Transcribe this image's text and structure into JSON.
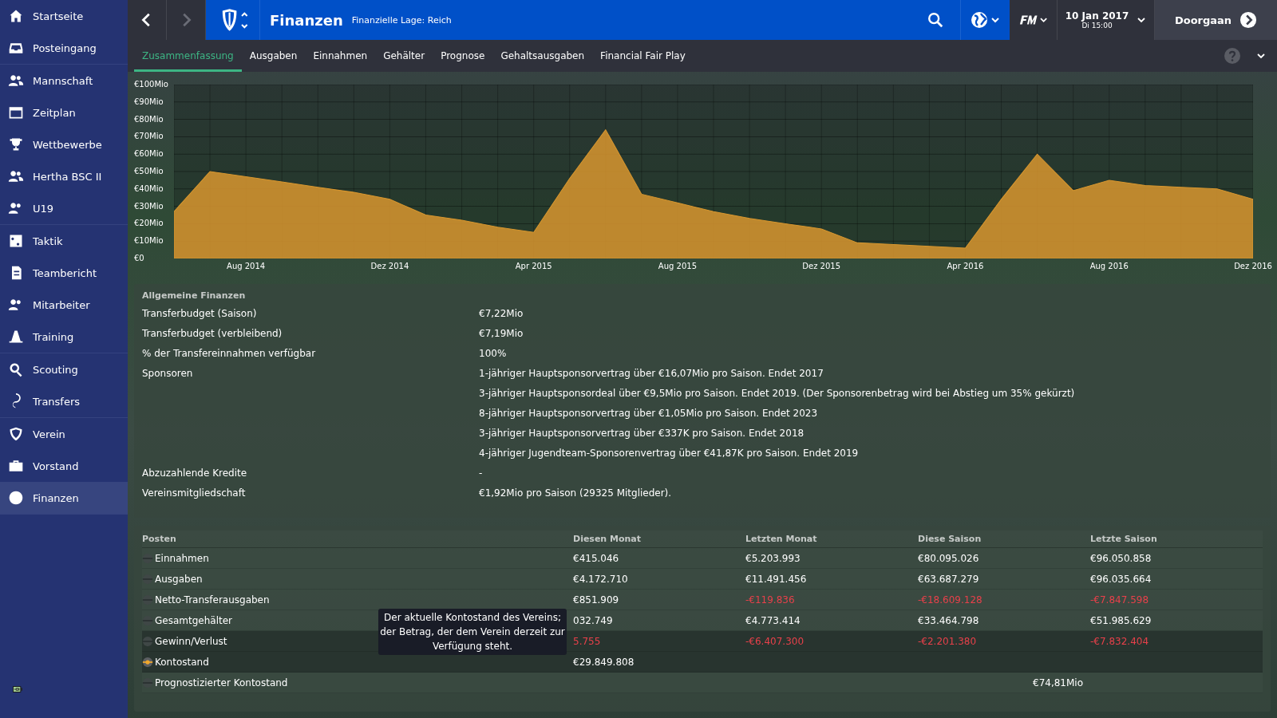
{
  "sidebar": {
    "groups": [
      [
        {
          "label": "Startseite",
          "selected": false
        },
        {
          "label": "Posteingang",
          "selected": false
        }
      ],
      [
        {
          "label": "Mannschaft",
          "selected": false
        },
        {
          "label": "Zeitplan",
          "selected": false
        },
        {
          "label": "Wettbewerbe",
          "selected": false
        },
        {
          "label": "Hertha BSC II",
          "selected": false
        },
        {
          "label": "U19",
          "selected": false
        }
      ],
      [
        {
          "label": "Taktik",
          "selected": false
        },
        {
          "label": "Teambericht",
          "selected": false
        },
        {
          "label": "Mitarbeiter",
          "selected": false
        },
        {
          "label": "Training",
          "selected": false
        }
      ],
      [
        {
          "label": "Scouting",
          "selected": false
        },
        {
          "label": "Transfers",
          "selected": false
        }
      ],
      [
        {
          "label": "Verein",
          "selected": false
        },
        {
          "label": "Vorstand",
          "selected": false
        },
        {
          "label": "Finanzen",
          "selected": true
        }
      ]
    ]
  },
  "header": {
    "title": "Finanzen",
    "subtitle": "Finanzielle Lage: Reich",
    "date": "10 Jan 2017",
    "time": "Di 15:00",
    "continue": "Doorgaan"
  },
  "tabs": [
    {
      "label": "Zusammenfassung",
      "selected": true
    },
    {
      "label": "Ausgaben",
      "selected": false
    },
    {
      "label": "Einnahmen",
      "selected": false
    },
    {
      "label": "Gehälter",
      "selected": false
    },
    {
      "label": "Prognose",
      "selected": false
    },
    {
      "label": "Gehaltsausgaben",
      "selected": false
    },
    {
      "label": "Financial Fair Play",
      "selected": false
    }
  ],
  "chart_data": {
    "type": "area",
    "categories": [
      null,
      null,
      "Aug 2014",
      null,
      null,
      null,
      "Dez 2014",
      null,
      null,
      null,
      "Apr 2015",
      null,
      null,
      null,
      "Aug 2015",
      null,
      null,
      null,
      "Dez 2015",
      null,
      null,
      null,
      "Apr 2016",
      null,
      null,
      null,
      "Aug 2016",
      null,
      null,
      null,
      "Dez 2016"
    ],
    "series": [
      {
        "color": "#d9972f",
        "values": [
          27,
          50,
          47,
          44,
          41,
          38,
          34,
          25,
          22,
          18,
          15,
          46,
          74,
          37,
          32,
          27,
          23,
          20,
          17,
          9,
          8,
          7,
          6,
          34,
          60,
          39,
          45,
          42,
          41,
          40,
          34
        ]
      }
    ],
    "ylim": [
      0,
      100
    ],
    "grid": true,
    "yticks": [
      {
        "value": 0,
        "label": "€0"
      },
      {
        "value": 10,
        "label": "€10Mio"
      },
      {
        "value": 20,
        "label": "€20Mio"
      },
      {
        "value": 30,
        "label": "€30Mio"
      },
      {
        "value": 40,
        "label": "€40Mio"
      },
      {
        "value": 50,
        "label": "€50Mio"
      },
      {
        "value": 60,
        "label": "€60Mio"
      },
      {
        "value": 70,
        "label": "€70Mio"
      },
      {
        "value": 80,
        "label": "€80Mio"
      },
      {
        "value": 90,
        "label": "€90Mio"
      },
      {
        "value": 100,
        "label": "€100Mio"
      }
    ]
  },
  "general": {
    "title": "Allgemeine Finanzen",
    "rows": [
      {
        "label": "Transferbudget (Saison)",
        "values": [
          "€7,22Mio"
        ]
      },
      {
        "label": "Transferbudget (verbleibend)",
        "values": [
          "€7,19Mio"
        ]
      },
      {
        "label": "% der Transfereinnahmen verfügbar",
        "values": [
          "100%"
        ]
      },
      {
        "label": "Sponsoren",
        "values": [
          "1-jähriger Hauptsponsorvertrag über €16,07Mio pro Saison. Endet 2017",
          "3-jähriger Hauptsponsordeal über €9,5Mio pro Saison. Endet 2019. (Der Sponsorenbetrag wird bei Abstieg um 35% gekürzt)",
          "8-jähriger Hauptsponsorvertrag über €1,05Mio pro Saison. Endet 2023",
          "3-jähriger Hauptsponsorvertrag über €337K pro Saison. Endet 2018",
          "4-jähriger Jugendteam-Sponsorenvertrag über €41,87K pro Saison. Endet 2019"
        ]
      },
      {
        "label": "Abzuzahlende Kredite",
        "values": [
          "-"
        ]
      },
      {
        "label": "Vereinsmitgliedschaft",
        "values": [
          "€1,92Mio pro Saison (29325 Mitglieder)."
        ]
      }
    ]
  },
  "table": {
    "columns": [
      "Posten",
      "Diesen Monat",
      "Letzten Monat",
      "Diese Saison",
      "Letzte Saison"
    ],
    "rows": [
      {
        "selected": false,
        "highlighted": false,
        "cells": [
          {
            "text": "Einnahmen",
            "negative": false
          },
          {
            "text": "€415.046",
            "negative": false
          },
          {
            "text": "€5.203.993",
            "negative": false
          },
          {
            "text": "€80.095.026",
            "negative": false
          },
          {
            "text": "€96.050.858",
            "negative": false
          }
        ]
      },
      {
        "selected": false,
        "highlighted": false,
        "cells": [
          {
            "text": "Ausgaben",
            "negative": false
          },
          {
            "text": "€4.172.710",
            "negative": false
          },
          {
            "text": "€11.491.456",
            "negative": false
          },
          {
            "text": "€63.687.279",
            "negative": false
          },
          {
            "text": "€96.035.664",
            "negative": false
          }
        ]
      },
      {
        "selected": false,
        "highlighted": false,
        "cells": [
          {
            "text": "Netto-Transferausgaben",
            "negative": false
          },
          {
            "text": "€851.909",
            "negative": false
          },
          {
            "text": "-€119.836",
            "negative": true
          },
          {
            "text": "-€18.609.128",
            "negative": true
          },
          {
            "text": "-€7.847.598",
            "negative": true
          }
        ]
      },
      {
        "selected": false,
        "highlighted": false,
        "cells": [
          {
            "text": "Gesamtgehälter",
            "negative": false
          },
          {
            "text": "032.749",
            "negative": false
          },
          {
            "text": "€4.773.414",
            "negative": false
          },
          {
            "text": "€33.464.798",
            "negative": false
          },
          {
            "text": "€51.985.629",
            "negative": false
          }
        ]
      },
      {
        "selected": false,
        "highlighted": true,
        "cells": [
          {
            "text": "Gewinn/Verlust",
            "negative": false
          },
          {
            "text": "5.755",
            "negative": true
          },
          {
            "text": "-€6.407.300",
            "negative": true
          },
          {
            "text": "-€2.201.380",
            "negative": true
          },
          {
            "text": "-€7.832.404",
            "negative": true
          }
        ]
      },
      {
        "selected": true,
        "highlighted": true,
        "cells": [
          {
            "text": "Kontostand",
            "negative": false
          },
          {
            "text": "€29.849.808",
            "negative": false
          }
        ]
      },
      {
        "selected": false,
        "highlighted": false,
        "cells": [
          {
            "text": "Prognostizierter Kontostand",
            "negative": false
          },
          null,
          null,
          {
            "text": "€74,81Mio",
            "negative": false
          }
        ]
      }
    ]
  },
  "tooltip": "Der aktuelle Kontostand des Vereins; der Betrag, der dem Verein derzeit zur Verfügung steht."
}
